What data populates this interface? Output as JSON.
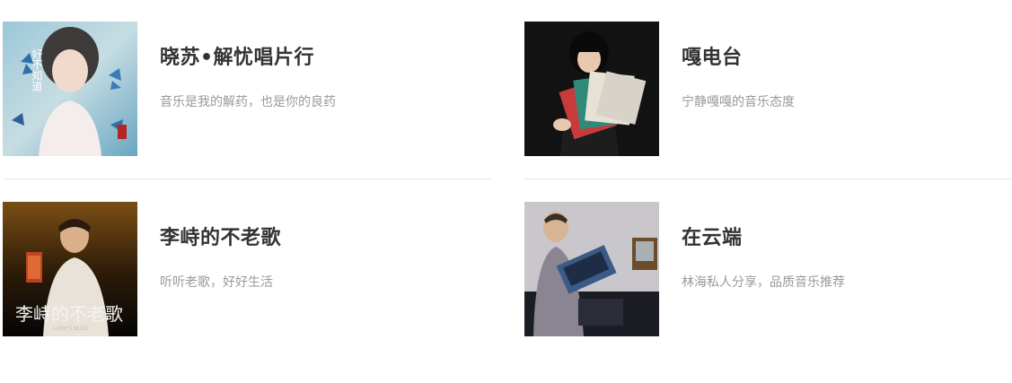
{
  "channels": [
    {
      "title": "晓苏•解忧唱片行",
      "desc": "音乐是我的解药，也是你的良药",
      "cover_icon": "album-cover-butterfly-woman"
    },
    {
      "title": "嘎电台",
      "desc": "宁静嘎嘎的音乐态度",
      "cover_icon": "album-cover-vinyl-records"
    },
    {
      "title": "李峙的不老歌",
      "desc": "听听老歌，好好生活",
      "cover_icon": "album-cover-man-phone"
    },
    {
      "title": "在云端",
      "desc": "林海私人分享，品质音乐推荐",
      "cover_icon": "album-cover-man-record-player"
    }
  ],
  "cover_text": {
    "c0_calligraphy": "好不知道",
    "c2_logo": "李峙的不老歌",
    "c2_sub": "LIZHI'S BLOG"
  },
  "colors": {
    "title": "#333333",
    "desc": "#999999",
    "divider": "#e6e6e6"
  }
}
